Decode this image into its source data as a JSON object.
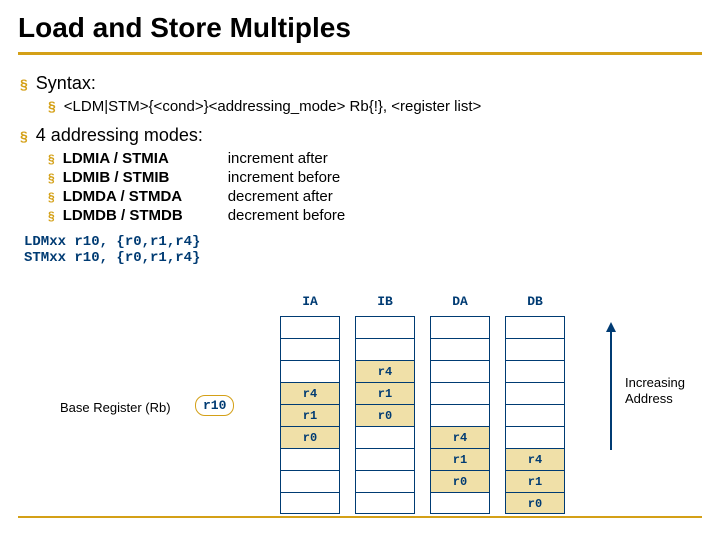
{
  "title": "Load and Store Multiples",
  "syntax_label": "Syntax:",
  "syntax_text": "<LDM|STM>{<cond>}<addressing_mode> Rb{!}, <register list>",
  "modes_label": "4 addressing modes:",
  "modes": [
    {
      "name": "LDMIA / STMIA",
      "desc": "increment after"
    },
    {
      "name": "LDMIB / STMIB",
      "desc": "increment before"
    },
    {
      "name": "LDMDA / STMDA",
      "desc": "decrement after"
    },
    {
      "name": "LDMDB / STMDB",
      "desc": "decrement before"
    }
  ],
  "code": {
    "line1": "LDMxx r10, {r0,r1,r4}",
    "line2": "STMxx r10, {r0,r1,r4}"
  },
  "base_register_label": "Base Register (Rb)",
  "base_register_value": "r10",
  "columns": {
    "ia": "IA",
    "ib": "IB",
    "da": "DA",
    "db": "DB"
  },
  "stacks": {
    "ia": [
      "",
      "",
      "",
      "r4",
      "r1",
      "r0",
      "",
      "",
      ""
    ],
    "ib": [
      "",
      "",
      "r4",
      "r1",
      "r0",
      "",
      "",
      "",
      ""
    ],
    "da": [
      "",
      "",
      "",
      "",
      "",
      "r4",
      "r1",
      "r0",
      ""
    ],
    "db": [
      "",
      "",
      "",
      "",
      "",
      "",
      "r4",
      "r1",
      "r0"
    ]
  },
  "base_row_index": 5,
  "increasing_label": "Increasing\nAddress"
}
